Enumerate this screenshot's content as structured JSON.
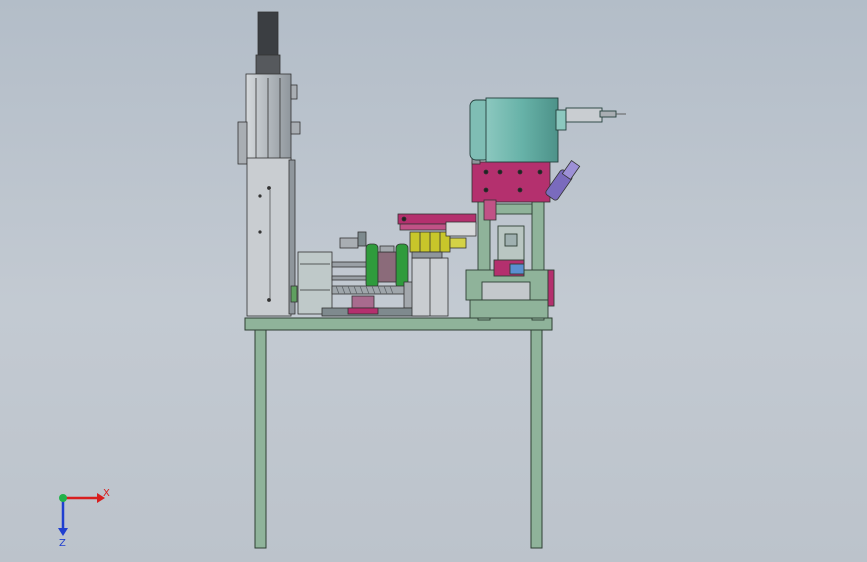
{
  "viewport": {
    "background_top": "#b3bdc8",
    "background_bottom": "#bcc3cb"
  },
  "triad": {
    "x_label": "X",
    "z_label": "Z",
    "x_color": "#d81e1e",
    "y_color": "#22b24a",
    "z_color": "#1f3fd0"
  },
  "colors": {
    "frame_green": "#8fb39a",
    "frame_edge": "#2e3f33",
    "motor_teal": "#67b2a8",
    "bracket_magenta": "#b4306e",
    "actuator_gray": "#b9bec3",
    "gear_green": "#2f9b3c",
    "valve_yellow": "#c8c62a",
    "cylinder_purple": "#7a6bbd"
  }
}
